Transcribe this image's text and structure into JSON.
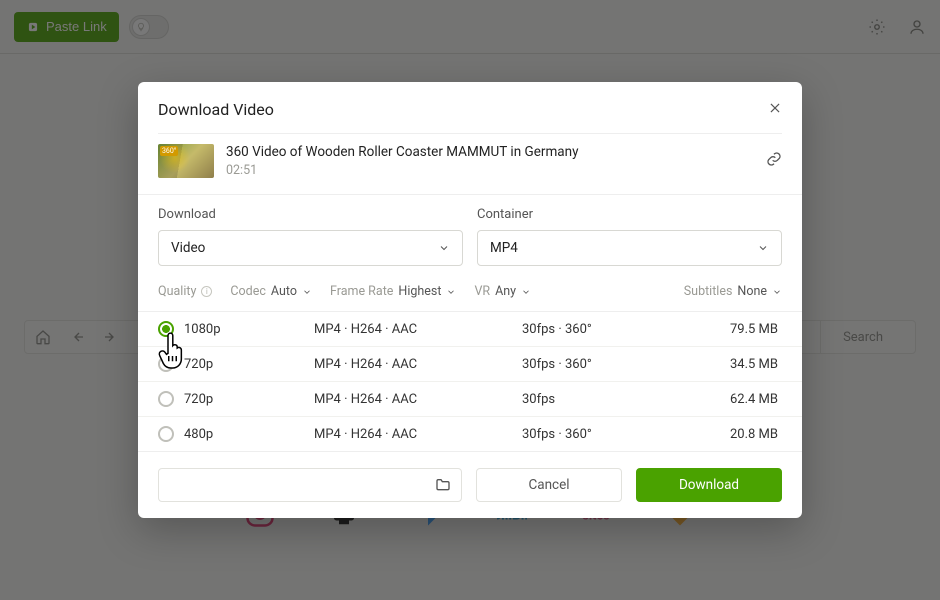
{
  "topbar": {
    "paste_label": "Paste Link"
  },
  "browser": {
    "search_label": "Search"
  },
  "modal": {
    "title": "Download Video",
    "video_title": "360 Video of Wooden Roller Coaster MAMMUT in Germany",
    "duration": "02:51",
    "download_label": "Download",
    "download_type": "Video",
    "container_label": "Container",
    "container_value": "MP4",
    "quality_label": "Quality",
    "codec_label": "Codec",
    "codec_value": "Auto",
    "framerate_label": "Frame Rate",
    "framerate_value": "Highest",
    "vr_label": "VR",
    "vr_value": "Any",
    "subtitles_label": "Subtitles",
    "subtitles_value": "None",
    "qualities": [
      {
        "res": "1080p",
        "codec": "MP4 · H264 · AAC",
        "fps": "30fps · 360°",
        "size": "79.5 MB"
      },
      {
        "res": "720p",
        "codec": "MP4 · H264 · AAC",
        "fps": "30fps · 360°",
        "size": "34.5 MB"
      },
      {
        "res": "720p",
        "codec": "MP4 · H264 · AAC",
        "fps": "30fps",
        "size": "62.4 MB"
      },
      {
        "res": "480p",
        "codec": "MP4 · H264 · AAC",
        "fps": "30fps · 360°",
        "size": "20.8 MB"
      }
    ],
    "cancel_label": "Cancel",
    "download_btn_label": "Download"
  }
}
